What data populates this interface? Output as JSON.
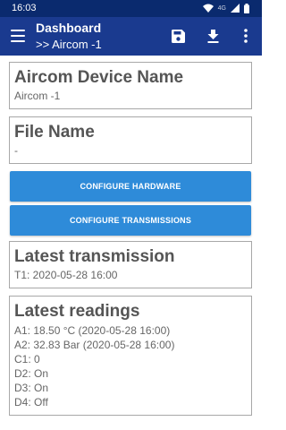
{
  "status_bar": {
    "time": "16:03",
    "network_label": "4G",
    "icons": [
      "wifi-icon",
      "cell-signal-icon",
      "battery-icon"
    ]
  },
  "app_bar": {
    "title": "Dashboard",
    "subtitle": ">> Aircom -1",
    "actions": [
      "save-icon",
      "download-icon",
      "more-vert-icon"
    ]
  },
  "device_card": {
    "title": "Aircom Device Name",
    "value": "Aircom -1"
  },
  "file_card": {
    "title": "File Name",
    "value": "-"
  },
  "buttons": {
    "configure_hardware": "CONFIGURE HARDWARE",
    "configure_transmissions": "CONFIGURE TRANSMISSIONS"
  },
  "latest_transmission": {
    "title": "Latest transmission",
    "value": "T1: 2020-05-28 16:00"
  },
  "latest_readings": {
    "title": "Latest readings",
    "items": [
      "A1: 18.50 °C (2020-05-28 16:00)",
      "A2: 32.83 Bar (2020-05-28 16:00)",
      "C1: 0",
      "D2: On",
      "D3: On",
      "D4: Off"
    ]
  },
  "colors": {
    "status_bar": "#0a2a6e",
    "app_bar": "#1a3a8f",
    "button": "#2e8bd9",
    "card_border": "#a8a8a8",
    "title_text": "#555555"
  }
}
